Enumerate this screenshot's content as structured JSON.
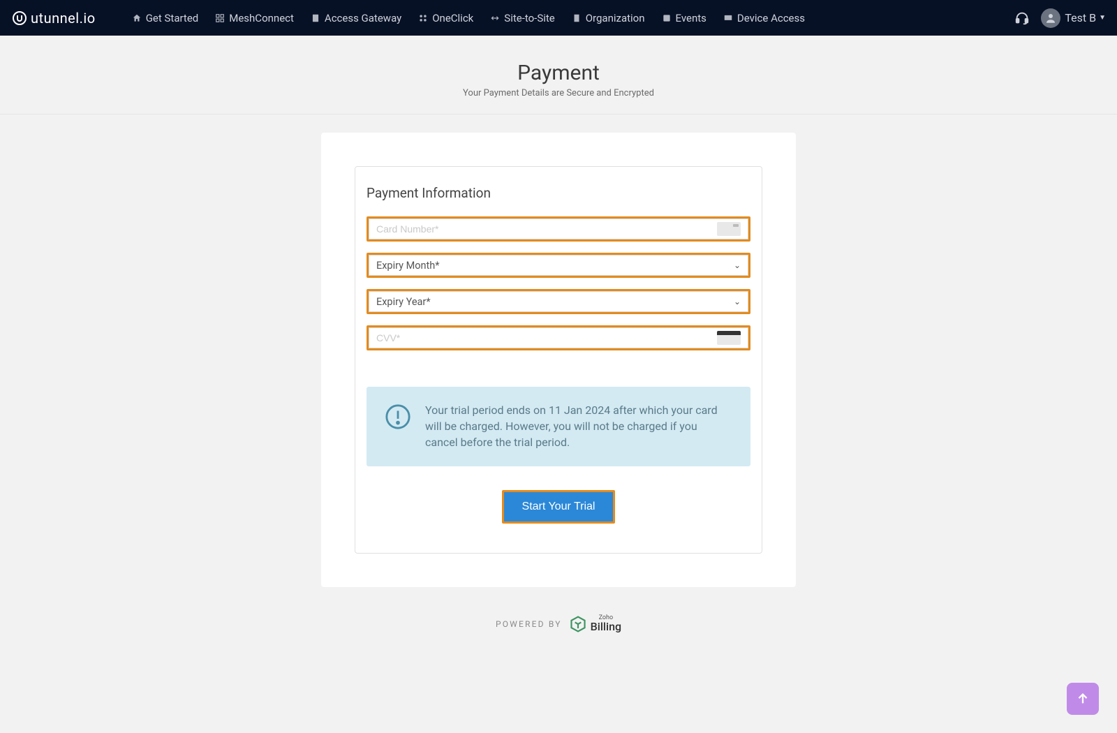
{
  "brand": "utunnel.io",
  "nav": [
    {
      "label": "Get Started",
      "icon": "home-icon"
    },
    {
      "label": "MeshConnect",
      "icon": "mesh-icon"
    },
    {
      "label": "Access Gateway",
      "icon": "server-icon"
    },
    {
      "label": "OneClick",
      "icon": "oneclick-icon"
    },
    {
      "label": "Site-to-Site",
      "icon": "site-icon"
    },
    {
      "label": "Organization",
      "icon": "org-icon"
    },
    {
      "label": "Events",
      "icon": "events-icon"
    },
    {
      "label": "Device Access",
      "icon": "device-icon"
    }
  ],
  "user": {
    "name": "Test B"
  },
  "page": {
    "title": "Payment",
    "subtitle": "Your Payment Details are Secure and Encrypted"
  },
  "payment": {
    "heading": "Payment Information",
    "card_number_placeholder": "Card Number*",
    "expiry_month_label": "Expiry Month*",
    "expiry_year_label": "Expiry Year*",
    "cvv_placeholder": "CVV*",
    "info_message": "Your trial period ends on 11 Jan 2024 after which your card will be charged. However, you will not be charged if you cancel before the trial period.",
    "cta_label": "Start Your Trial"
  },
  "footer": {
    "powered_by": "POWERED BY",
    "zoho_small": "Zoho",
    "zoho_big": "Billing"
  },
  "colors": {
    "highlight_border": "#e38b1e",
    "cta_bg": "#2b88d8",
    "navbar_bg": "#071126"
  }
}
